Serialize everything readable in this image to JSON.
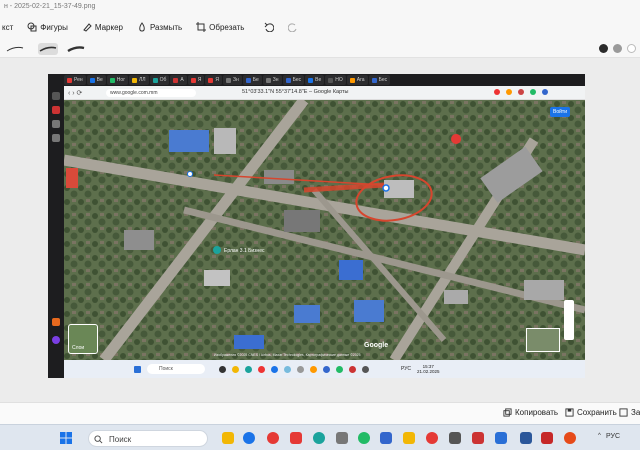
{
  "editor": {
    "title": "н - 2025-02-21_15-37-49.png",
    "tools": [
      {
        "label": "кст",
        "icon": "text-icon"
      },
      {
        "label": "Фигуры",
        "icon": "shapes-icon"
      },
      {
        "label": "Маркер",
        "icon": "marker-icon"
      },
      {
        "label": "Размыть",
        "icon": "blur-icon"
      },
      {
        "label": "Обрезать",
        "icon": "crop-icon"
      }
    ],
    "undo_icon": "undo-icon",
    "redo_icon": "redo-icon",
    "colors": [
      "#2b2b2b",
      "#9a9a9a",
      "#ffffff"
    ],
    "actions": {
      "copy": "Копировать",
      "save": "Сохранить",
      "close": "За"
    }
  },
  "browser": {
    "tabs": [
      "Рен",
      "Ве",
      "Ног",
      "ЛЛ",
      "Об",
      "А",
      "Я",
      "Я",
      "Зн",
      "Бе",
      "Зн",
      "Бес",
      "Ве",
      "НО",
      "Ага",
      "Бес"
    ],
    "url": "www.google.com.mm",
    "page_title": "51°03'33.1\"N 55°37'14.8\"E – Google Карты"
  },
  "map": {
    "sign_in": "Войти",
    "place_label": "Ерлан 3.1 Бизнес",
    "layers_label": "Слои",
    "google_logo": "Google",
    "attribution": "Изображения ©2025 CNES / Airbus, Maxar Technologies, Картографические данные ©2025"
  },
  "inner_taskbar": {
    "search": "Поиск",
    "lang": "РУС",
    "time": "15:37",
    "date": "21.02.2025"
  },
  "taskbar": {
    "search": "Поиск",
    "lang": "РУС"
  }
}
